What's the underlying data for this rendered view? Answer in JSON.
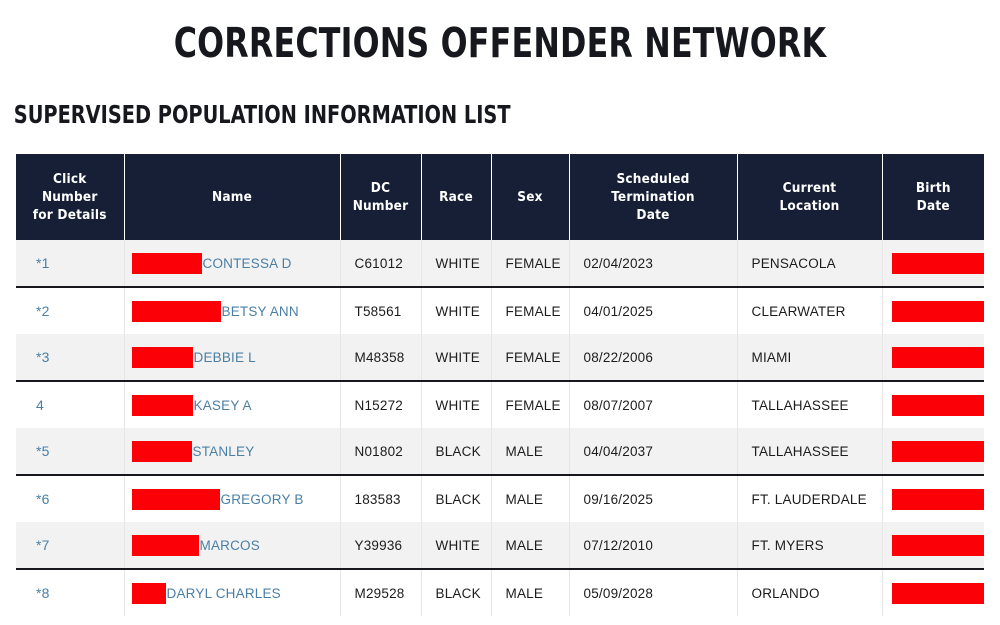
{
  "header": {
    "title": "CORRECTIONS OFFENDER NETWORK",
    "subtitle": "SUPERVISED POPULATION INFORMATION LIST"
  },
  "colors": {
    "header_bg": "#161f35",
    "link_blue": "#4a7fa5",
    "redaction_red": "#fb0007",
    "row_shade": "#f2f2f2",
    "text": "#1c1c1c"
  },
  "table": {
    "columns": [
      {
        "key": "number",
        "label": "Click\nNumber\nfor Details",
        "lines": [
          "Click",
          "Number",
          "for Details"
        ]
      },
      {
        "key": "name",
        "label": "Name",
        "lines": [
          "Name"
        ]
      },
      {
        "key": "dc_number",
        "label": "DC Number",
        "lines": [
          "DC",
          "Number"
        ]
      },
      {
        "key": "race",
        "label": "Race",
        "lines": [
          "Race"
        ]
      },
      {
        "key": "sex",
        "label": "Sex",
        "lines": [
          "Sex"
        ]
      },
      {
        "key": "scheduled_termination_date",
        "label": "Scheduled Termination Date",
        "lines": [
          "Scheduled",
          "Termination",
          "Date"
        ]
      },
      {
        "key": "current_location",
        "label": "Current Location",
        "lines": [
          "Current",
          "Location"
        ]
      },
      {
        "key": "birth_date",
        "label": "Birth Date",
        "lines": [
          "Birth",
          "Date"
        ]
      }
    ],
    "rows": [
      {
        "number": "*1",
        "name_redaction_width": 70,
        "name": "CONTESSA D",
        "dc_number": "C61012",
        "race": "WHITE",
        "sex": "FEMALE",
        "scheduled_termination_date": "02/04/2023",
        "current_location": "PENSACOLA",
        "birth_date_redacted": true
      },
      {
        "number": "*2",
        "name_redaction_width": 89,
        "name": "BETSY ANN",
        "dc_number": "T58561",
        "race": "WHITE",
        "sex": "FEMALE",
        "scheduled_termination_date": "04/01/2025",
        "current_location": "CLEARWATER",
        "birth_date_redacted": true
      },
      {
        "number": "*3",
        "name_redaction_width": 61,
        "name": "DEBBIE L",
        "dc_number": "M48358",
        "race": "WHITE",
        "sex": "FEMALE",
        "scheduled_termination_date": "08/22/2006",
        "current_location": "MIAMI",
        "birth_date_redacted": true
      },
      {
        "number": "4",
        "name_redaction_width": 61,
        "name": "KASEY A",
        "dc_number": "N15272",
        "race": "WHITE",
        "sex": "FEMALE",
        "scheduled_termination_date": "08/07/2007",
        "current_location": "TALLAHASSEE",
        "birth_date_redacted": true
      },
      {
        "number": "*5",
        "name_redaction_width": 60,
        "name": "STANLEY",
        "dc_number": "N01802",
        "race": "BLACK",
        "sex": "MALE",
        "scheduled_termination_date": "04/04/2037",
        "current_location": "TALLAHASSEE",
        "birth_date_redacted": true
      },
      {
        "number": "*6",
        "name_redaction_width": 88,
        "name": "GREGORY B",
        "dc_number": "183583",
        "race": "BLACK",
        "sex": "MALE",
        "scheduled_termination_date": "09/16/2025",
        "current_location": "FT. LAUDERDALE",
        "birth_date_redacted": true
      },
      {
        "number": "*7",
        "name_redaction_width": 67,
        "name": "MARCOS",
        "dc_number": "Y39936",
        "race": "WHITE",
        "sex": "MALE",
        "scheduled_termination_date": "07/12/2010",
        "current_location": "FT. MYERS",
        "birth_date_redacted": true
      },
      {
        "number": "*8",
        "name_redaction_width": 34,
        "name": "DARYL CHARLES",
        "dc_number": "M29528",
        "race": "BLACK",
        "sex": "MALE",
        "scheduled_termination_date": "05/09/2028",
        "current_location": "ORLANDO",
        "birth_date_redacted": true
      }
    ]
  }
}
